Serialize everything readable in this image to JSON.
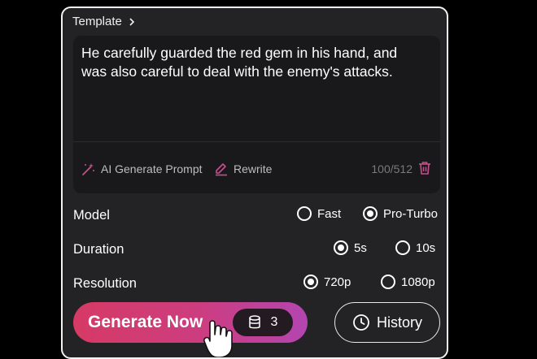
{
  "template": {
    "label": "Template"
  },
  "prompt": {
    "text": "He carefully guarded the red gem in his hand, and was also careful to deal with the enemy's attacks.",
    "ai_generate_label": "AI Generate Prompt",
    "rewrite_label": "Rewrite",
    "char_count": "100/512"
  },
  "model": {
    "label": "Model",
    "options": [
      "Fast",
      "Pro-Turbo"
    ],
    "selected": "Pro-Turbo"
  },
  "duration": {
    "label": "Duration",
    "options": [
      "5s",
      "10s"
    ],
    "selected": "5s"
  },
  "resolution": {
    "label": "Resolution",
    "options": [
      "720p",
      "1080p"
    ],
    "selected": "720p"
  },
  "generate": {
    "label": "Generate Now",
    "credits": "3"
  },
  "history": {
    "label": "History"
  },
  "colors": {
    "accent_start": "#d63a65",
    "accent_end": "#b345b0",
    "panel": "#232325"
  }
}
